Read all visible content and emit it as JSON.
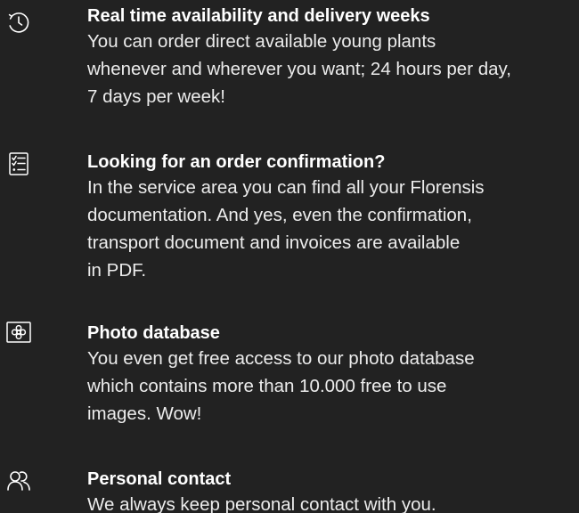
{
  "features": [
    {
      "icon": "clock-history-icon",
      "title": "Real time availability and delivery weeks",
      "lines": [
        "You can order direct available young plants",
        "whenever and wherever you want; 24 hours per day,",
        "7 days per week!"
      ]
    },
    {
      "icon": "checklist-icon",
      "title": "Looking for an order confirmation?",
      "lines": [
        "In the service area you can find all your Florensis",
        "documentation. And yes, even the confirmation,",
        "transport document and invoices are available",
        "in PDF."
      ]
    },
    {
      "icon": "flower-photo-icon",
      "title": "Photo database",
      "lines": [
        "You even get free access to our photo database",
        "which contains more than 10.000 free to use",
        "images. Wow!"
      ]
    },
    {
      "icon": "people-icon",
      "title": "Personal contact",
      "lines": [
        "We always keep personal contact with you."
      ]
    }
  ],
  "colors": {
    "background": "#222222",
    "text": "#ffffff"
  }
}
